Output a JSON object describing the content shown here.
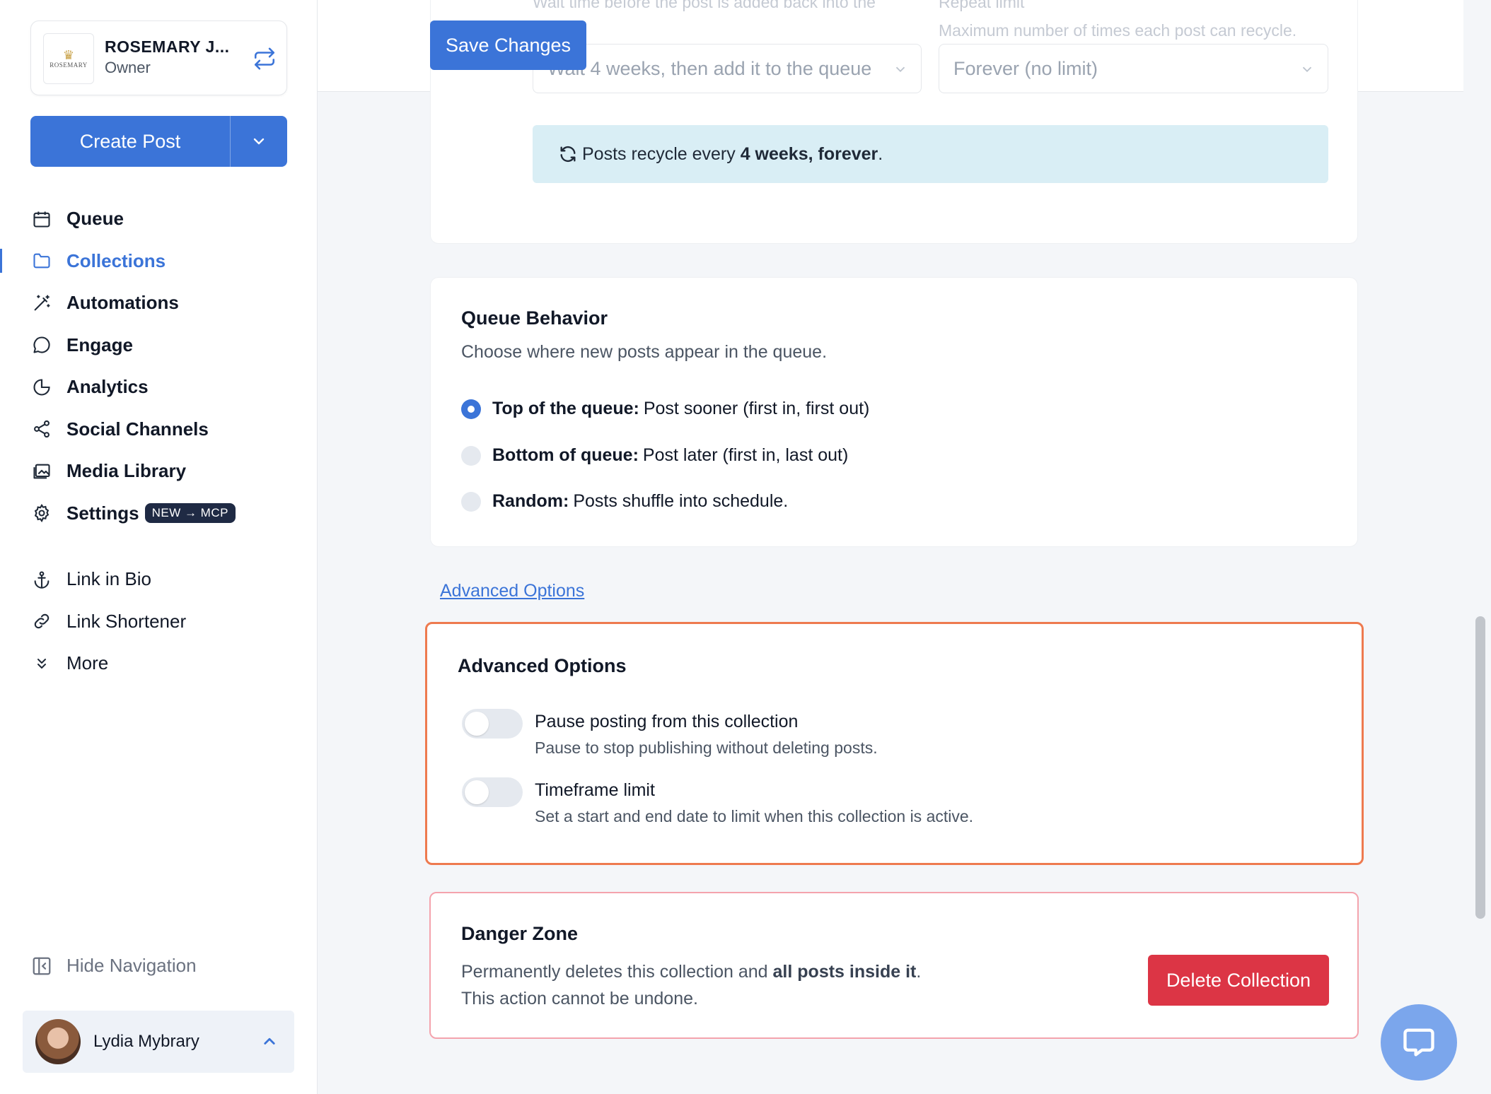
{
  "account": {
    "name": "ROSEMARY J...",
    "role": "Owner",
    "logo_text": "ROSEMARY"
  },
  "create_post": {
    "label": "Create Post"
  },
  "nav": {
    "items": [
      {
        "label": "Queue",
        "icon": "calendar-icon"
      },
      {
        "label": "Collections",
        "icon": "folder-icon",
        "active": true
      },
      {
        "label": "Automations",
        "icon": "magic-wand-icon"
      },
      {
        "label": "Engage",
        "icon": "chat-bubble-icon"
      },
      {
        "label": "Analytics",
        "icon": "pie-chart-icon"
      },
      {
        "label": "Social Channels",
        "icon": "share-nodes-icon"
      },
      {
        "label": "Media Library",
        "icon": "images-icon"
      },
      {
        "label": "Settings",
        "icon": "gear-icon",
        "badge": "NEW → MCP"
      }
    ],
    "secondary": [
      {
        "label": "Link in Bio",
        "icon": "anchor-icon"
      },
      {
        "label": "Link Shortener",
        "icon": "link-icon"
      },
      {
        "label": "More",
        "icon": "double-chevron-down-icon"
      }
    ],
    "hide_label": "Hide Navigation"
  },
  "user": {
    "name": "Lydia Mybrary"
  },
  "toolbar": {
    "save_label": "Save Changes"
  },
  "recycle": {
    "wait_label": "Wait time before the post is added back into the",
    "wait_value": "Wait 4 weeks, then add it to the queue",
    "repeat_label": "Repeat limit",
    "repeat_desc": "Maximum number of times each post can recycle.",
    "repeat_value": "Forever (no limit)",
    "info_prefix": "Posts recycle every ",
    "info_bold": "4 weeks, forever",
    "info_suffix": "."
  },
  "queue_behavior": {
    "title": "Queue Behavior",
    "subtitle": "Choose where new posts appear in the queue.",
    "options": [
      {
        "bold": "Top of the queue:",
        "text": "Post sooner (first in, first out)",
        "selected": true
      },
      {
        "bold": "Bottom of queue:",
        "text": "Post later (first in, last out)",
        "selected": false
      },
      {
        "bold": "Random:",
        "text": "Posts shuffle into schedule.",
        "selected": false
      }
    ]
  },
  "advanced_link": "Advanced Options",
  "advanced": {
    "title": "Advanced Options",
    "pause_title": "Pause posting from this collection",
    "pause_desc": "Pause to stop publishing without deleting posts.",
    "timeframe_title": "Timeframe limit",
    "timeframe_desc": "Set a start and end date to limit when this collection is active."
  },
  "danger": {
    "title": "Danger Zone",
    "desc_prefix": "Permanently deletes this collection and ",
    "desc_bold": "all posts inside it",
    "desc_suffix": ".",
    "desc_line2": "This action cannot be undone.",
    "delete_label": "Delete Collection"
  },
  "colors": {
    "accent": "#3b74d8",
    "danger": "#dc3545",
    "highlight_border": "#ee7a4f",
    "info_bg": "#d9eef5"
  }
}
